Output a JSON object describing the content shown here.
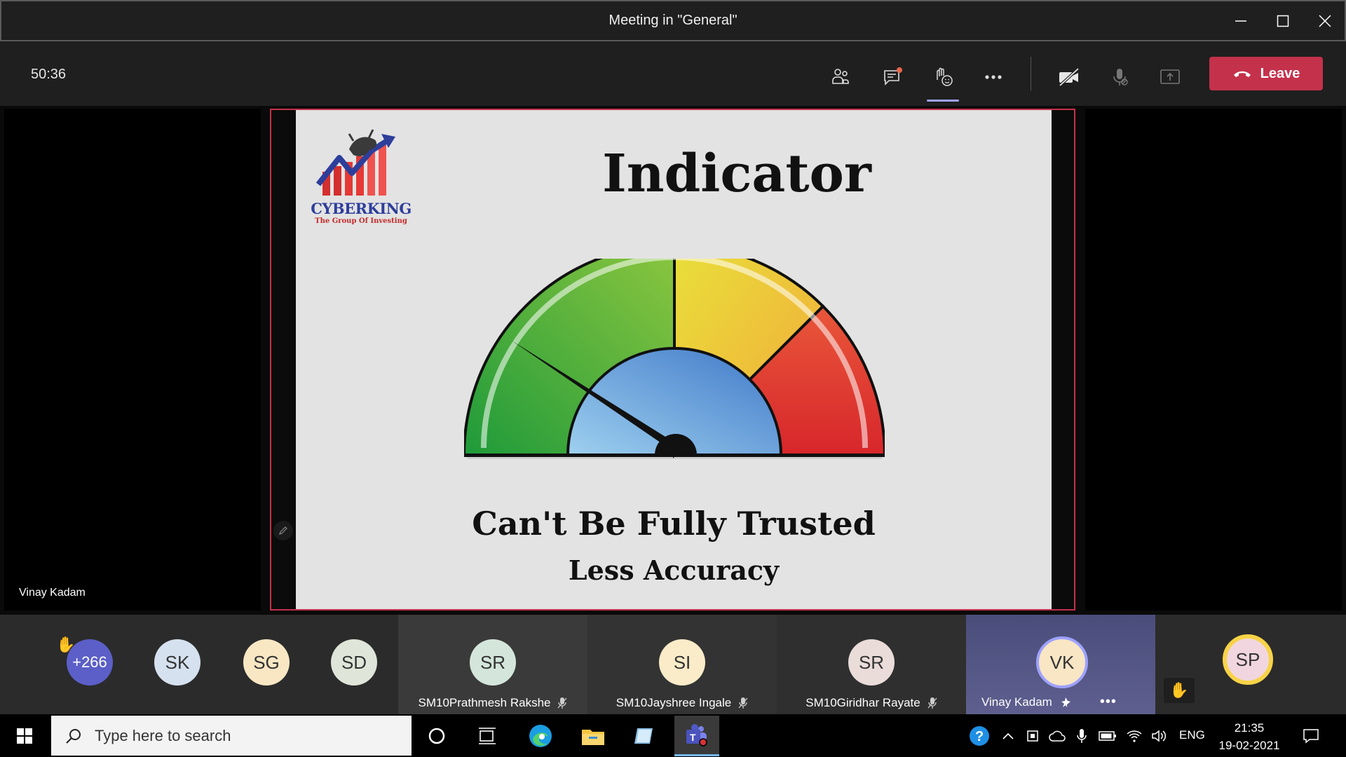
{
  "window": {
    "title": "Meeting in \"General\""
  },
  "toolbar": {
    "timer": "50:36",
    "leave_label": "Leave",
    "leave_color": "#c4314b"
  },
  "stage": {
    "left_participant_name": "Vinay Kadam",
    "slide": {
      "logo_name": "CYBERKING",
      "logo_tagline": "The Group Of Investing",
      "title": "Indicator",
      "caption": "Can't Be Fully Trusted",
      "subcaption": "Less Accuracy"
    }
  },
  "participants": {
    "overflow": {
      "count": "+266",
      "color": "#5b5fc7"
    },
    "tiles": [
      {
        "initials": "SK",
        "color": "#d6e1ef"
      },
      {
        "initials": "SG",
        "color": "#f9e7c4"
      },
      {
        "initials": "SD",
        "color": "#dfe6d9"
      },
      {
        "initials": "SR",
        "name": "SM10Prathmesh Rakshe",
        "color": "#d4e6dc"
      },
      {
        "initials": "SI",
        "name": "SM10Jayshree Ingale",
        "color": "#fbecc9"
      },
      {
        "initials": "SR",
        "name": "SM10Giridhar Rayate",
        "color": "#eadcd9"
      },
      {
        "initials": "VK",
        "name": "Vinay Kadam",
        "color": "#f9e6c4"
      },
      {
        "initials": "SP",
        "color": "#f1d6df"
      }
    ]
  },
  "taskbar": {
    "search_placeholder": "Type here to search",
    "language": "ENG",
    "time": "21:35",
    "date": "19-02-2021"
  }
}
